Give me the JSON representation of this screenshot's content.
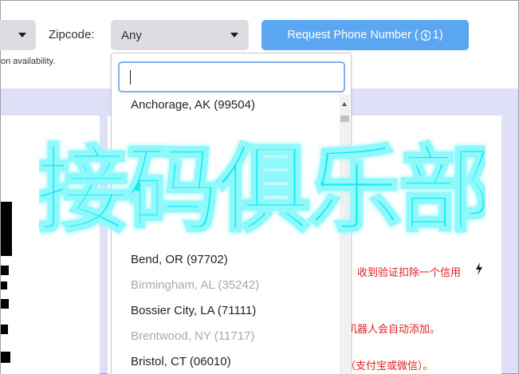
{
  "toolbar": {
    "zipcode_label": "Zipcode:",
    "zipcode_value": "Any",
    "request_button": "Request Phone Number (",
    "request_button_count": "1)",
    "availability_note": "on availability."
  },
  "dropdown": {
    "search_value": "",
    "items": [
      {
        "label": "Anchorage, AK (99504)",
        "enabled": true
      },
      {
        "label": "Bend, OR (97702)",
        "enabled": true
      },
      {
        "label": "Birmingham, AL (35242)",
        "enabled": false
      },
      {
        "label": "Bossier City, LA (71111)",
        "enabled": true
      },
      {
        "label": "Brentwood, NY (11717)",
        "enabled": false
      },
      {
        "label": "Bristol, CT (06010)",
        "enabled": true
      }
    ]
  },
  "info": {
    "line1": "。收到验证扣除一个信用",
    "line2": "机器人会自动添加。",
    "line3": "（支付宝或微信）。"
  },
  "watermark": {
    "text": "接码俱乐部",
    "color": "#17ecf0"
  },
  "colors": {
    "accent_button": "#5ba6f0",
    "info_text": "#e02020",
    "page_bg": "#dfe0f8"
  }
}
